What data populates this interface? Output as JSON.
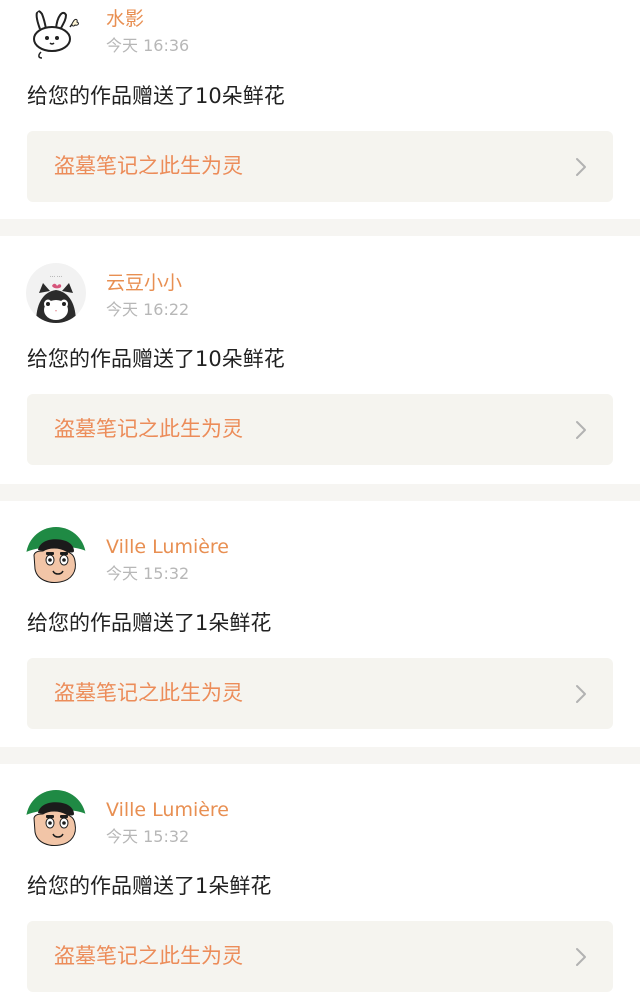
{
  "entries": [
    {
      "user": "水影",
      "time": "今天 16:36",
      "message": "给您的作品赠送了10朵鲜花",
      "work_title": "盗墓笔记之此生为灵",
      "avatar_icon": "rabbit-avatar-icon"
    },
    {
      "user": "云豆小小",
      "time": "今天 16:22",
      "message": "给您的作品赠送了10朵鲜花",
      "work_title": "盗墓笔记之此生为灵",
      "avatar_icon": "cat-avatar-icon"
    },
    {
      "user": "Ville Lumière",
      "time": "今天 15:32",
      "message": "给您的作品赠送了1朵鲜花",
      "work_title": "盗墓笔记之此生为灵",
      "avatar_icon": "cartoon-boy-avatar-icon"
    },
    {
      "user": "Ville Lumière",
      "time": "今天 15:32",
      "message": "给您的作品赠送了1朵鲜花",
      "work_title": "盗墓笔记之此生为灵",
      "avatar_icon": "cartoon-boy-avatar-icon"
    }
  ],
  "colors": {
    "accent": "#e88f52",
    "card_bg": "#f5f4ef",
    "divider": "#f6f5f2",
    "time": "#b7b7b7",
    "text": "#222222"
  }
}
